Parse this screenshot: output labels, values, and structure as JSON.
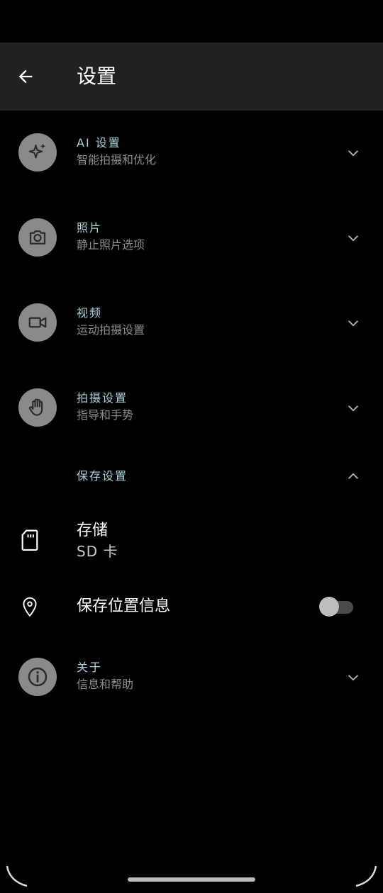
{
  "header": {
    "title": "设置",
    "back_icon": "arrow-left-icon"
  },
  "rows": [
    {
      "id": "ai",
      "title": "AI 设置",
      "subtitle": "智能拍摄和优化",
      "icon": "sparkle-icon",
      "expanded": false
    },
    {
      "id": "photo",
      "title": "照片",
      "subtitle": "静止照片选项",
      "icon": "camera-icon",
      "expanded": false
    },
    {
      "id": "video",
      "title": "视频",
      "subtitle": "运动拍摄设置",
      "icon": "video-camera-icon",
      "expanded": false
    },
    {
      "id": "capture",
      "title": "拍摄设置",
      "subtitle": "指导和手势",
      "icon": "hand-icon",
      "expanded": false
    }
  ],
  "save_section": {
    "title": "保存设置",
    "expanded": true,
    "storage": {
      "label": "存储",
      "value": "SD 卡",
      "icon": "sd-card-icon"
    },
    "location": {
      "label": "保存位置信息",
      "icon": "location-pin-icon",
      "enabled": false
    }
  },
  "about": {
    "title": "关于",
    "subtitle": "信息和帮助",
    "icon": "info-icon",
    "expanded": false
  },
  "colors": {
    "accent_text": "#a8d5df",
    "app_bar_bg": "#1f2123",
    "icon_circle": "#8a8a8a"
  }
}
